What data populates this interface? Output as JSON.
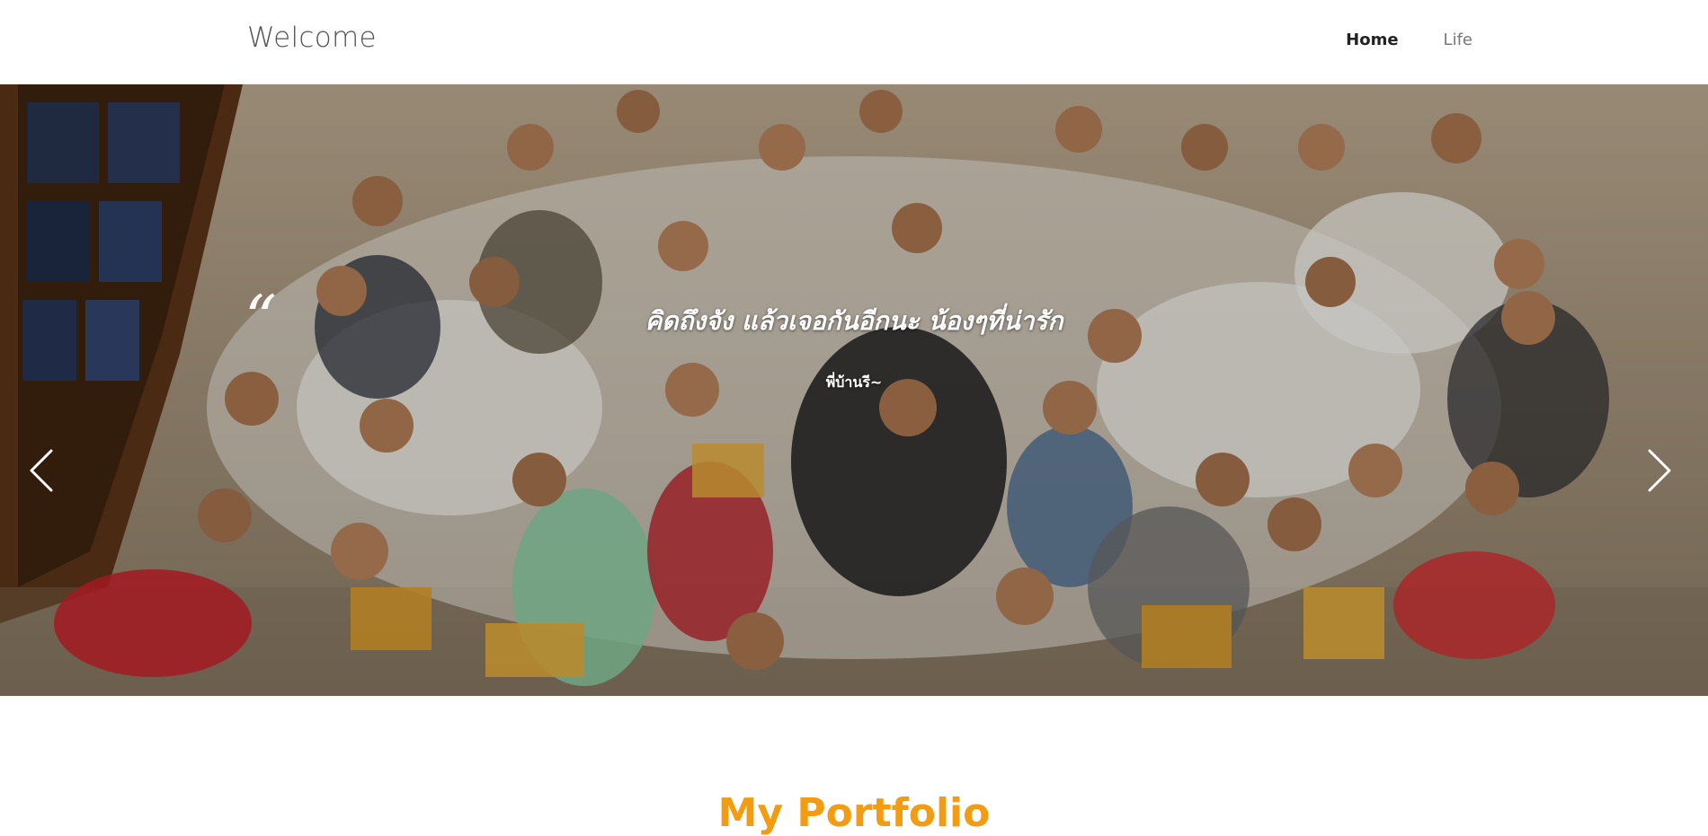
{
  "navbar": {
    "brand": "Welcome",
    "links": [
      {
        "label": "Home",
        "active": true
      },
      {
        "label": "Life",
        "active": false
      }
    ]
  },
  "hero": {
    "quote_mark": "“",
    "quote": "คิดถึงจัง แล้วเจอกันอีกนะ น้องๆที่น่ารัก",
    "author": "พี่บ้านรี~",
    "prev_icon": "chevron-left-icon",
    "next_icon": "chevron-right-icon"
  },
  "portfolio": {
    "title": "My Portfolio"
  },
  "colors": {
    "accent": "#f39c12",
    "nav_active": "#222222",
    "nav_inactive": "#777777"
  }
}
